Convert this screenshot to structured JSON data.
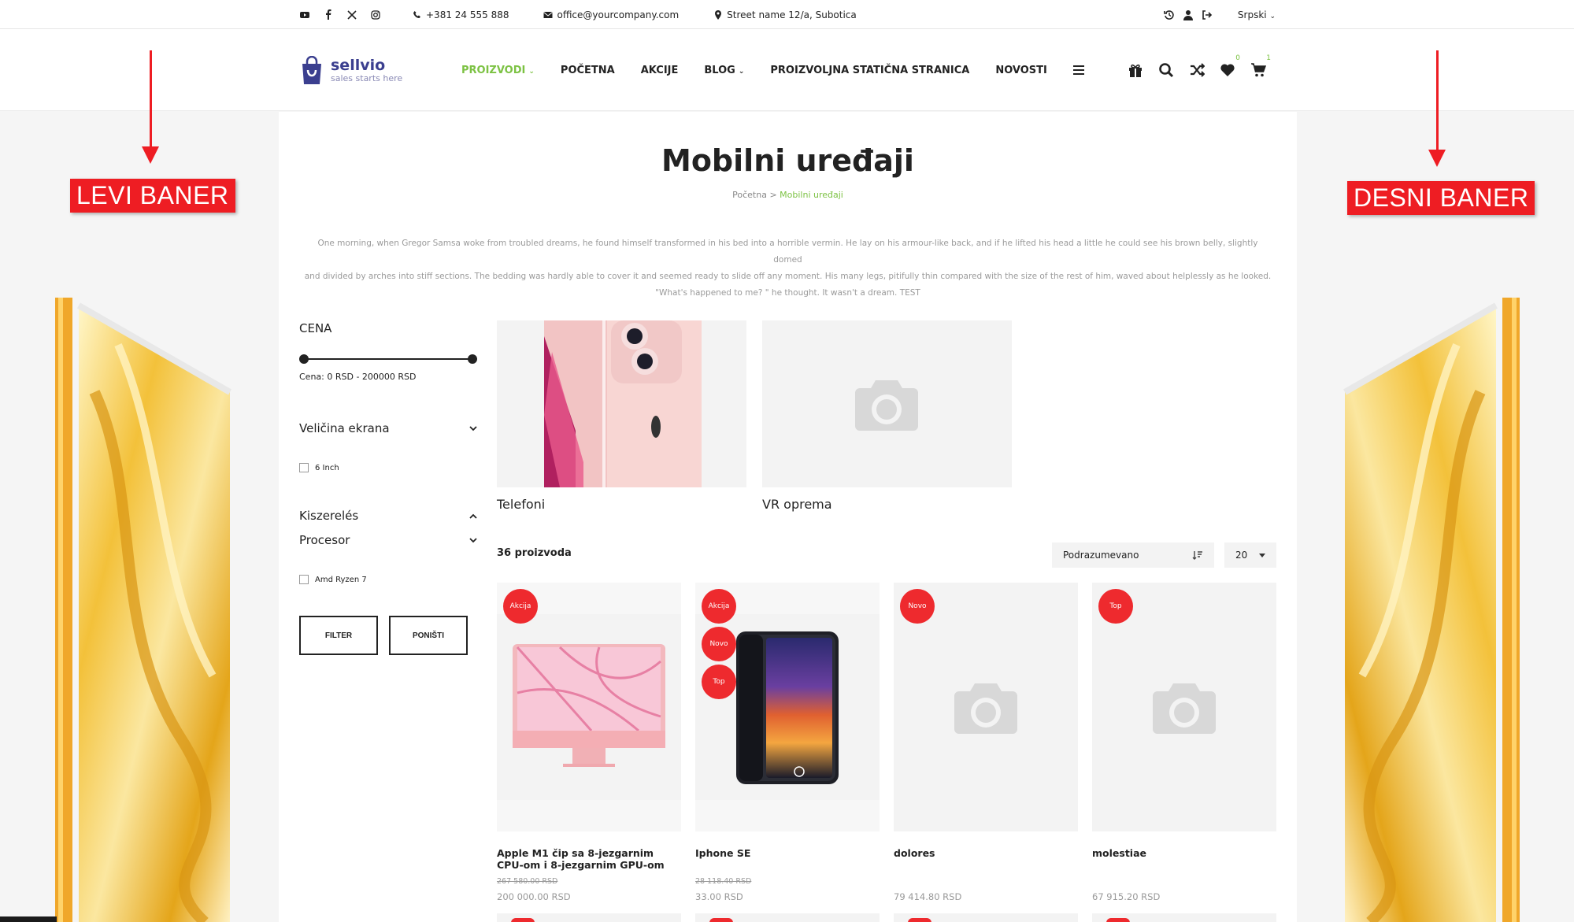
{
  "topbar": {
    "social_icons": [
      "youtube-icon",
      "facebook-icon",
      "x-icon",
      "instagram-icon"
    ],
    "phone": "+381 24 555 888",
    "email": "office@yourcompany.com",
    "address": "Street name 12/a, Subotica",
    "language": "Srpski"
  },
  "brand": {
    "name": "sellvio",
    "tagline": "sales starts here"
  },
  "nav": {
    "items": [
      "PROIZVODI",
      "POČETNA",
      "AKCIJE",
      "BLOG",
      "PROIZVOLJNA STATIČNA STRANICA",
      "NOVOSTI"
    ],
    "wishlist_count": "0",
    "cart_count": "1"
  },
  "banners": {
    "left_label": "LEVI BANER",
    "right_label": "DESNI BANER"
  },
  "page": {
    "title": "Mobilni uređaji",
    "breadcrumb_home": "Početna",
    "breadcrumb_sep": ">",
    "breadcrumb_current": "Mobilni uređaji",
    "description_lines": [
      "One morning, when Gregor Samsa woke from troubled dreams, he found himself transformed in his bed into a horrible vermin. He lay on his armour-like back, and if he lifted his head a little he could see his brown belly, slightly domed",
      "and divided by arches into stiff sections. The bedding was hardly able to cover it and seemed ready to slide off any moment. His many legs, pitifully thin compared with the size of the rest of him, waved about helplessly as he looked.",
      "\"What's happened to me? \" he thought. It wasn't a dream. TEST"
    ]
  },
  "filters": {
    "price_title": "CENA",
    "price_text": "Cena: 0 RSD - 200000 RSD",
    "screen_size_title": "Veličina ekrana",
    "screen_size_option": "6 Inch",
    "packaging_title": "Kiszerelés",
    "processor_title": "Procesor",
    "processor_option": "Amd Ryzen 7",
    "filter_button": "FILTER",
    "reset_button": "PONIŠTI"
  },
  "categories": [
    {
      "name": "Telefoni"
    },
    {
      "name": "VR oprema"
    }
  ],
  "toolbar": {
    "product_count": "36 proizvoda",
    "sort_value": "Podrazumevano",
    "per_page": "20"
  },
  "products": [
    {
      "name": "Apple M1 čip sa 8-jezgarnim CPU-om i 8-jezgarnim GPU-om",
      "old_price": "267 580.00 RSD",
      "price": "200 000.00 RSD",
      "badges": [
        "Akcija"
      ]
    },
    {
      "name": "Iphone SE",
      "old_price": "28 118.40 RSD",
      "price": "33.00 RSD",
      "badges": [
        "Akcija",
        "Novo",
        "Top"
      ]
    },
    {
      "name": "dolores",
      "old_price": "",
      "price": "79 414.80 RSD",
      "badges": [
        "Novo"
      ]
    },
    {
      "name": "molestiae",
      "old_price": "",
      "price": "67 915.20 RSD",
      "badges": [
        "Top"
      ]
    }
  ],
  "colors": {
    "accent": "#7cc243",
    "badge": "#ee2a2e",
    "banner_label": "#ee1d23",
    "brand": "#3b3f8f"
  }
}
